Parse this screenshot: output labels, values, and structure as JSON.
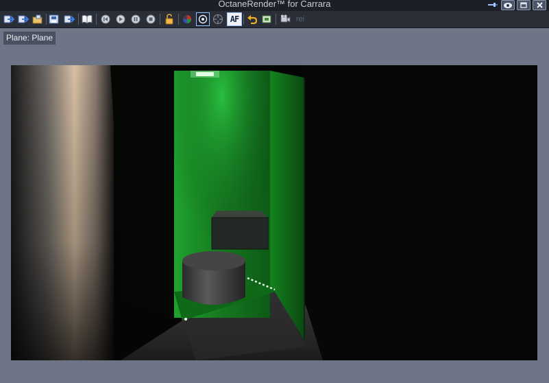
{
  "window": {
    "title": "OctaneRender™ for Carrara"
  },
  "window_controls": [
    {
      "icon": "pin-icon"
    },
    {
      "icon": "eye-icon"
    },
    {
      "icon": "maximize-icon"
    },
    {
      "icon": "close-icon"
    }
  ],
  "toolbar": {
    "buttons": [
      {
        "icon": "import-arrow-icon"
      },
      {
        "icon": "export-arrow-icon"
      },
      {
        "icon": "open-folder-icon"
      },
      {
        "icon": "save-image-icon"
      },
      {
        "icon": "send-arrow-icon"
      },
      {
        "icon": "book-icon"
      },
      {
        "icon": "restart-icon"
      },
      {
        "icon": "play-icon"
      },
      {
        "icon": "pause-icon"
      },
      {
        "icon": "stop-icon"
      },
      {
        "icon": "lock-icon"
      },
      {
        "icon": "color-sphere-icon"
      },
      {
        "icon": "camera-focus-icon"
      },
      {
        "icon": "target-icon"
      },
      {
        "icon": "autofocus-icon"
      },
      {
        "icon": "undo-icon"
      },
      {
        "icon": "region-render-icon"
      },
      {
        "icon": "movie-camera-icon"
      },
      {
        "icon": "rei-icon"
      }
    ],
    "af_label": "AF",
    "rei_label": "rei"
  },
  "viewport": {
    "label": "Plane: Plane"
  },
  "colors": {
    "titlebar": "#1c1f26",
    "toolbar": "#2a2e37",
    "panel": "#6e7586",
    "render_bg": "#050505",
    "wall_green": "#1f8f2a"
  }
}
